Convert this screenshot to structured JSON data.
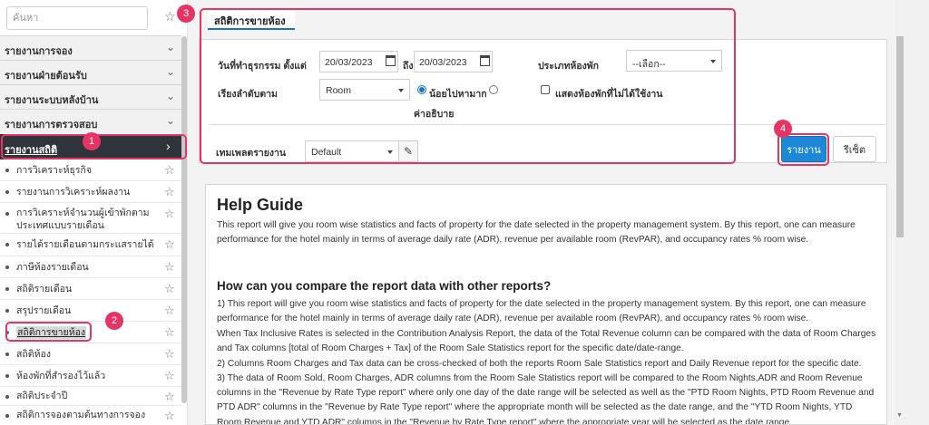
{
  "sidebar": {
    "search_placeholder": "ค้นหา",
    "sections": [
      {
        "label": "รายงานการจอง"
      },
      {
        "label": "รายงานฝ่ายต้อนรับ"
      },
      {
        "label": "รายงานระบบหลังบ้าน"
      },
      {
        "label": "รายงานการตรวจสอบ"
      },
      {
        "label": "รายงานสถิติ"
      }
    ],
    "items": [
      {
        "label": "การวิเคราะห์ธุรกิจ"
      },
      {
        "label": "รายงานการวิเคราะห์ผลงาน"
      },
      {
        "label": "การวิเคราะห์จำนวนผู้เข้าพักตามประเทศแบบรายเดือน"
      },
      {
        "label": "รายได้รายเดือนตามกระแสรายได้"
      },
      {
        "label": "ภาษีห้องรายเดือน"
      },
      {
        "label": "สถิติรายเดือน"
      },
      {
        "label": "สรุปรายเดือน"
      },
      {
        "label": "สถิติการขายห้อง"
      },
      {
        "label": "สถิติห้อง"
      },
      {
        "label": "ห้องพักที่สำรองไว้แล้ว"
      },
      {
        "label": "สถิติประจำปี"
      },
      {
        "label": "สถิติการจองตามต้นทางการจอง"
      }
    ]
  },
  "main": {
    "tab_label": "สถิติการขายห้อง",
    "filters": {
      "date_label": "วันที่ทำธุรกรรม ตั้งแต่",
      "date_from": "20/03/2023",
      "date_to_label": "ถึง",
      "date_to": "20/03/2023",
      "room_type_label": "ประเภทห้องพัก",
      "room_type_value": "--เลือก--",
      "sort_label": "เรียงลำดับตาม",
      "sort_value": "Room",
      "sort_desc_label": "น้อยไปหามาก",
      "sort_asc_label": "ค่าอธิบาย",
      "show_unused_label": "แสดงห้องพักที่ไม่ได้ใช้งาน",
      "template_label": "เทมเพลตรายงาน",
      "template_value": "Default"
    },
    "buttons": {
      "report": "รายงาน",
      "reset": "รีเซ็ต"
    },
    "help": {
      "title": "Help Guide",
      "intro": "This report will give you room wise statistics and facts of property for the date selected in the property management system. By this report, one can measure performance for the hotel mainly in terms of average daily rate (ADR), revenue per available room (RevPAR), and occupancy rates % room wise.",
      "subtitle": "How can you compare the report data with other reports?",
      "p1": "1) This report will give you room wise statistics and facts of property for the date selected in the property management system. By this report, one can measure performance for the hotel mainly in terms of average daily rate (ADR), revenue per available room (RevPAR), and occupancy rates % room wise.",
      "p2": "When Tax Inclusive Rates is selected in the Contribution Analysis Report, the data of the Total Revenue column can be compared with the data of Room Charges and Tax columns [total of Room Charges + Tax] of the Room Sale Statistics report for the specific date/date-range.",
      "p3": "2) Columns Room Charges and Tax data can be cross-checked of both the reports Room Sale Statistics report and Daily Revenue report for the specific date.",
      "p4": "3) The data of Room Sold, Room Charges, ADR columns from the Room Sale Statistics report will be compared to the Room Nights,ADR and Room Revenue columns in the \"Revenue by Rate Type report\" where only one day of the date range will be selected as well as the \"PTD Room Nights, PTD Room Revenue and PTD ADR\" columns in the \"Revenue by Rate Type report\" where the appropriate month will be selected as the date range, and the \"YTD Room Nights, YTD Room Revenue and YTD ADR\" columns in the \"Revenue by Rate Type report\" where the appropriate year will be selected as the date range."
    }
  },
  "annotations": [
    "1",
    "2",
    "3",
    "4"
  ],
  "colors": {
    "accent": "#1e88d8",
    "highlight": "#e53567",
    "active_section_bg": "#2f343a"
  },
  "icons": {
    "star": "star-icon",
    "chevron": "chevron-down-icon",
    "calendar": "calendar-icon",
    "edit": "edit-icon"
  }
}
